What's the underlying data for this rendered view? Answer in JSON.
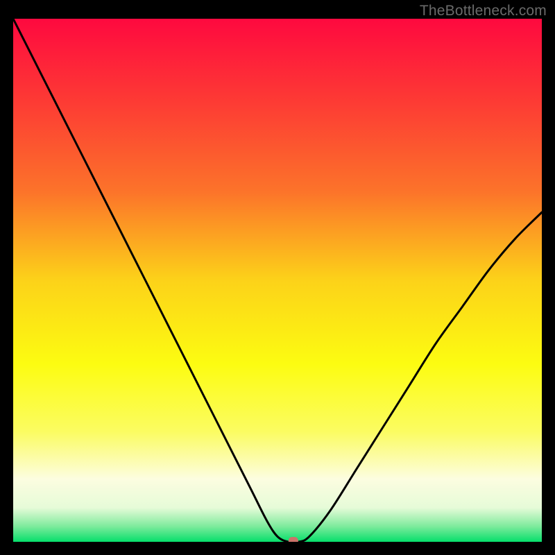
{
  "watermark": "TheBottleneck.com",
  "chart_data": {
    "type": "line",
    "title": "",
    "xlabel": "",
    "ylabel": "",
    "xlim": [
      0,
      100
    ],
    "ylim": [
      0,
      100
    ],
    "x": [
      0,
      5,
      10,
      15,
      20,
      25,
      30,
      35,
      40,
      45,
      48,
      50,
      52,
      54,
      56,
      60,
      65,
      70,
      75,
      80,
      85,
      90,
      95,
      100
    ],
    "values": [
      100,
      90,
      80,
      70,
      60,
      50,
      40,
      30,
      20,
      10,
      4,
      1,
      0,
      0,
      1,
      6,
      14,
      22,
      30,
      38,
      45,
      52,
      58,
      63
    ],
    "series_name": "bottleneck-curve",
    "marker": {
      "x": 53,
      "y": 0,
      "color": "#cb7269"
    },
    "background_gradient": {
      "stops": [
        {
          "offset": 0.0,
          "color": "#fe093f"
        },
        {
          "offset": 0.16,
          "color": "#fd3b34"
        },
        {
          "offset": 0.33,
          "color": "#fc732a"
        },
        {
          "offset": 0.5,
          "color": "#fcd219"
        },
        {
          "offset": 0.66,
          "color": "#fcfc11"
        },
        {
          "offset": 0.79,
          "color": "#fbfc62"
        },
        {
          "offset": 0.88,
          "color": "#fcfde0"
        },
        {
          "offset": 0.935,
          "color": "#e6fbd8"
        },
        {
          "offset": 0.97,
          "color": "#7feb9d"
        },
        {
          "offset": 1.0,
          "color": "#06df6b"
        }
      ]
    }
  }
}
